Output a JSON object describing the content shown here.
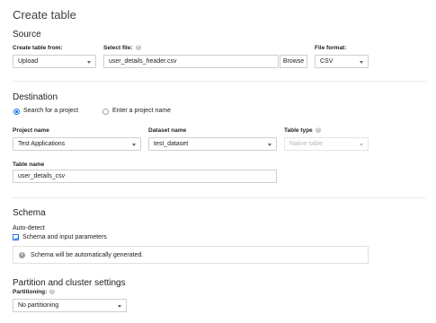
{
  "title": "Create table",
  "source": {
    "heading": "Source",
    "create_from_label": "Create table from:",
    "create_from_value": "Upload",
    "select_file_label": "Select file:",
    "file_name": "user_details_header.csv",
    "browse_label": "Browse",
    "file_format_label": "File format:",
    "file_format_value": "CSV"
  },
  "destination": {
    "heading": "Destination",
    "radio_search": "Search for a project",
    "radio_enter": "Enter a project name",
    "project_label": "Project name",
    "project_value": "Test Applications",
    "dataset_label": "Dataset name",
    "dataset_value": "test_dataset",
    "table_type_label": "Table type",
    "table_type_value": "Native table",
    "table_name_label": "Table name",
    "table_name_value": "user_details_csv"
  },
  "schema": {
    "heading": "Schema",
    "auto_detect_label": "Auto-detect",
    "checkbox_label": "Schema and input parameters",
    "info_text": "Schema will be automatically generated."
  },
  "partition": {
    "heading": "Partition and cluster settings",
    "partitioning_label": "Partitioning:",
    "partitioning_value": "No partitioning"
  },
  "colors": {
    "accent": "#1a73e8",
    "border": "#cfcfcf"
  }
}
